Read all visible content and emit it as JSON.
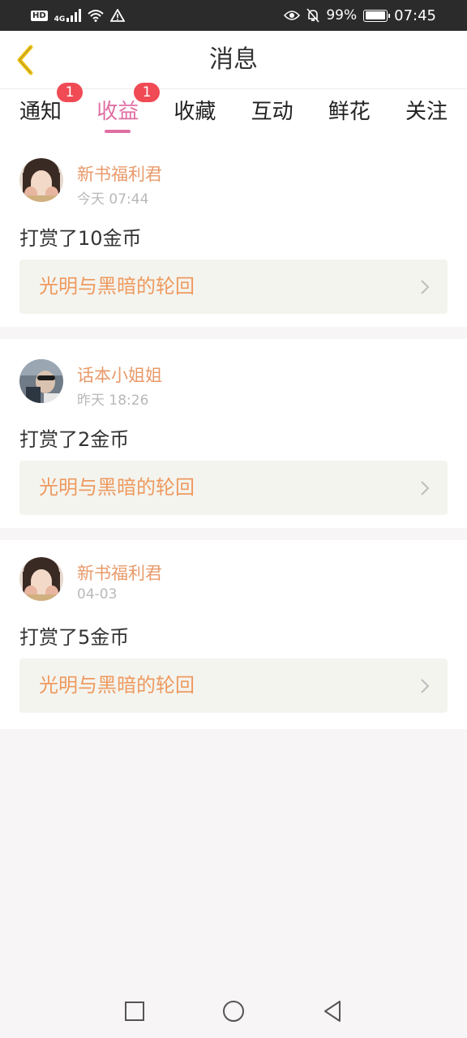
{
  "status_bar": {
    "hd": "HD",
    "network": "4G",
    "battery_percent": "99%",
    "battery_level": 0.99,
    "time": "07:45",
    "icons": [
      "signal-icon",
      "wifi-icon",
      "warning-icon",
      "eye-icon",
      "bell-muted-icon",
      "battery-icon"
    ]
  },
  "header": {
    "title": "消息",
    "back_icon": "back-chevron-icon"
  },
  "tabs": [
    {
      "label": "通知",
      "badge": "1",
      "active": false
    },
    {
      "label": "收益",
      "badge": "1",
      "active": true
    },
    {
      "label": "收藏",
      "active": false
    },
    {
      "label": "互动",
      "active": false
    },
    {
      "label": "鲜花",
      "active": false
    },
    {
      "label": "关注",
      "active": false
    }
  ],
  "messages": [
    {
      "user": "新书福利君",
      "time": "今天 07:44",
      "text": "打赏了10金币",
      "book": "光明与黑暗的轮回"
    },
    {
      "user": "话本小姐姐",
      "time": "昨天 18:26",
      "text": "打赏了2金币",
      "book": "光明与黑暗的轮回"
    },
    {
      "user": "新书福利君",
      "time": "04-03",
      "text": "打赏了5金币",
      "book": "光明与黑暗的轮回"
    }
  ],
  "colors": {
    "accent": "#e06fa3",
    "username": "#e89a6a",
    "book_title": "#ee9a5f",
    "badge": "#f04a55",
    "back_icon": "#f0c419"
  },
  "nav_bar": {
    "icons": [
      "recents-square-icon",
      "home-circle-icon",
      "back-triangle-icon"
    ]
  }
}
